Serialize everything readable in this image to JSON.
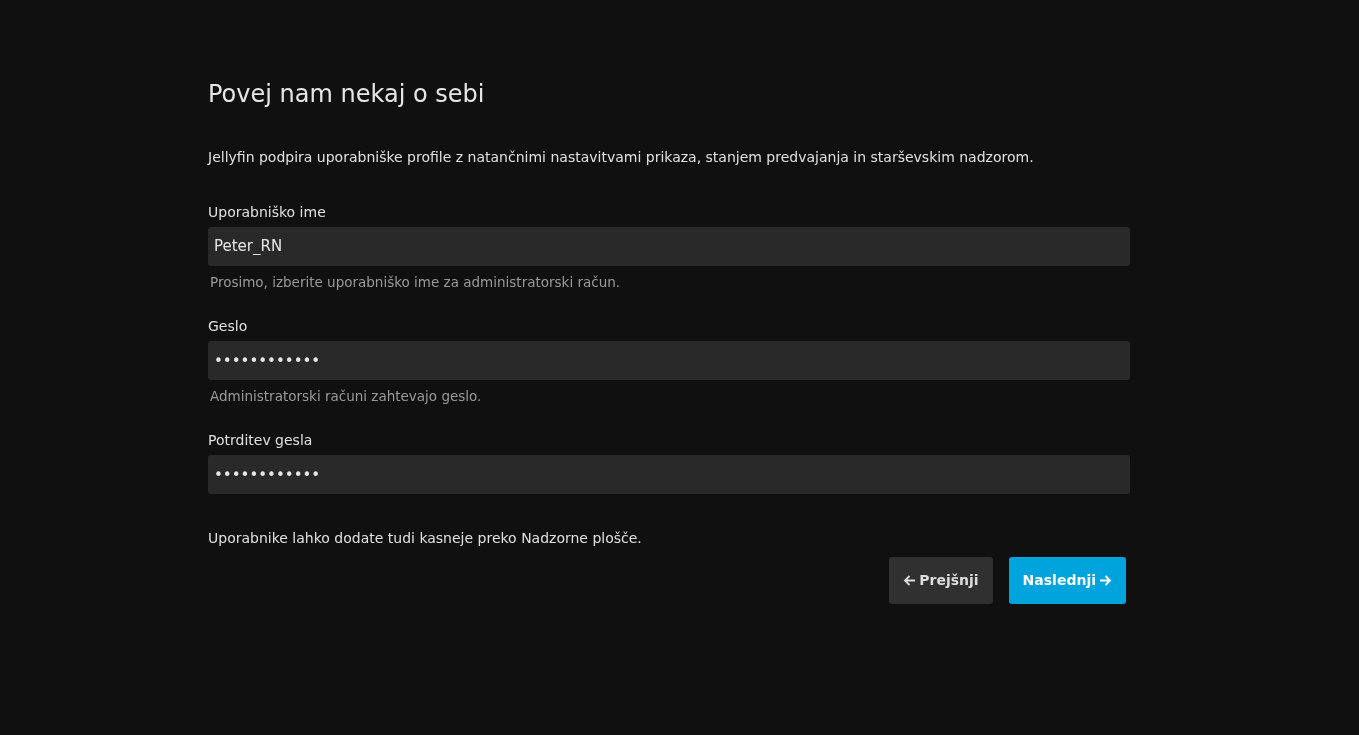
{
  "title": "Povej nam nekaj o sebi",
  "intro": "Jellyfin podpira uporabniške profile z natančnimi nastavitvami prikaza, stanjem predvajanja in starševskim nadzorom.",
  "fields": [
    {
      "label": "Uporabniško ime",
      "value": "Peter_RN",
      "help": "Prosimo, izberite uporabniško ime za administratorski račun."
    },
    {
      "label": "Geslo",
      "value": "••••••••••••",
      "help": "Administratorski računi zahtevajo geslo."
    },
    {
      "label": "Potrditev gesla",
      "value": "••••••••••••"
    }
  ],
  "note": "Uporabnike lahko dodate tudi kasneje preko Nadzorne plošče.",
  "buttons": [
    {
      "label": "Prejšnji",
      "kind": "back"
    },
    {
      "label": "Naslednji",
      "kind": "next"
    }
  ]
}
